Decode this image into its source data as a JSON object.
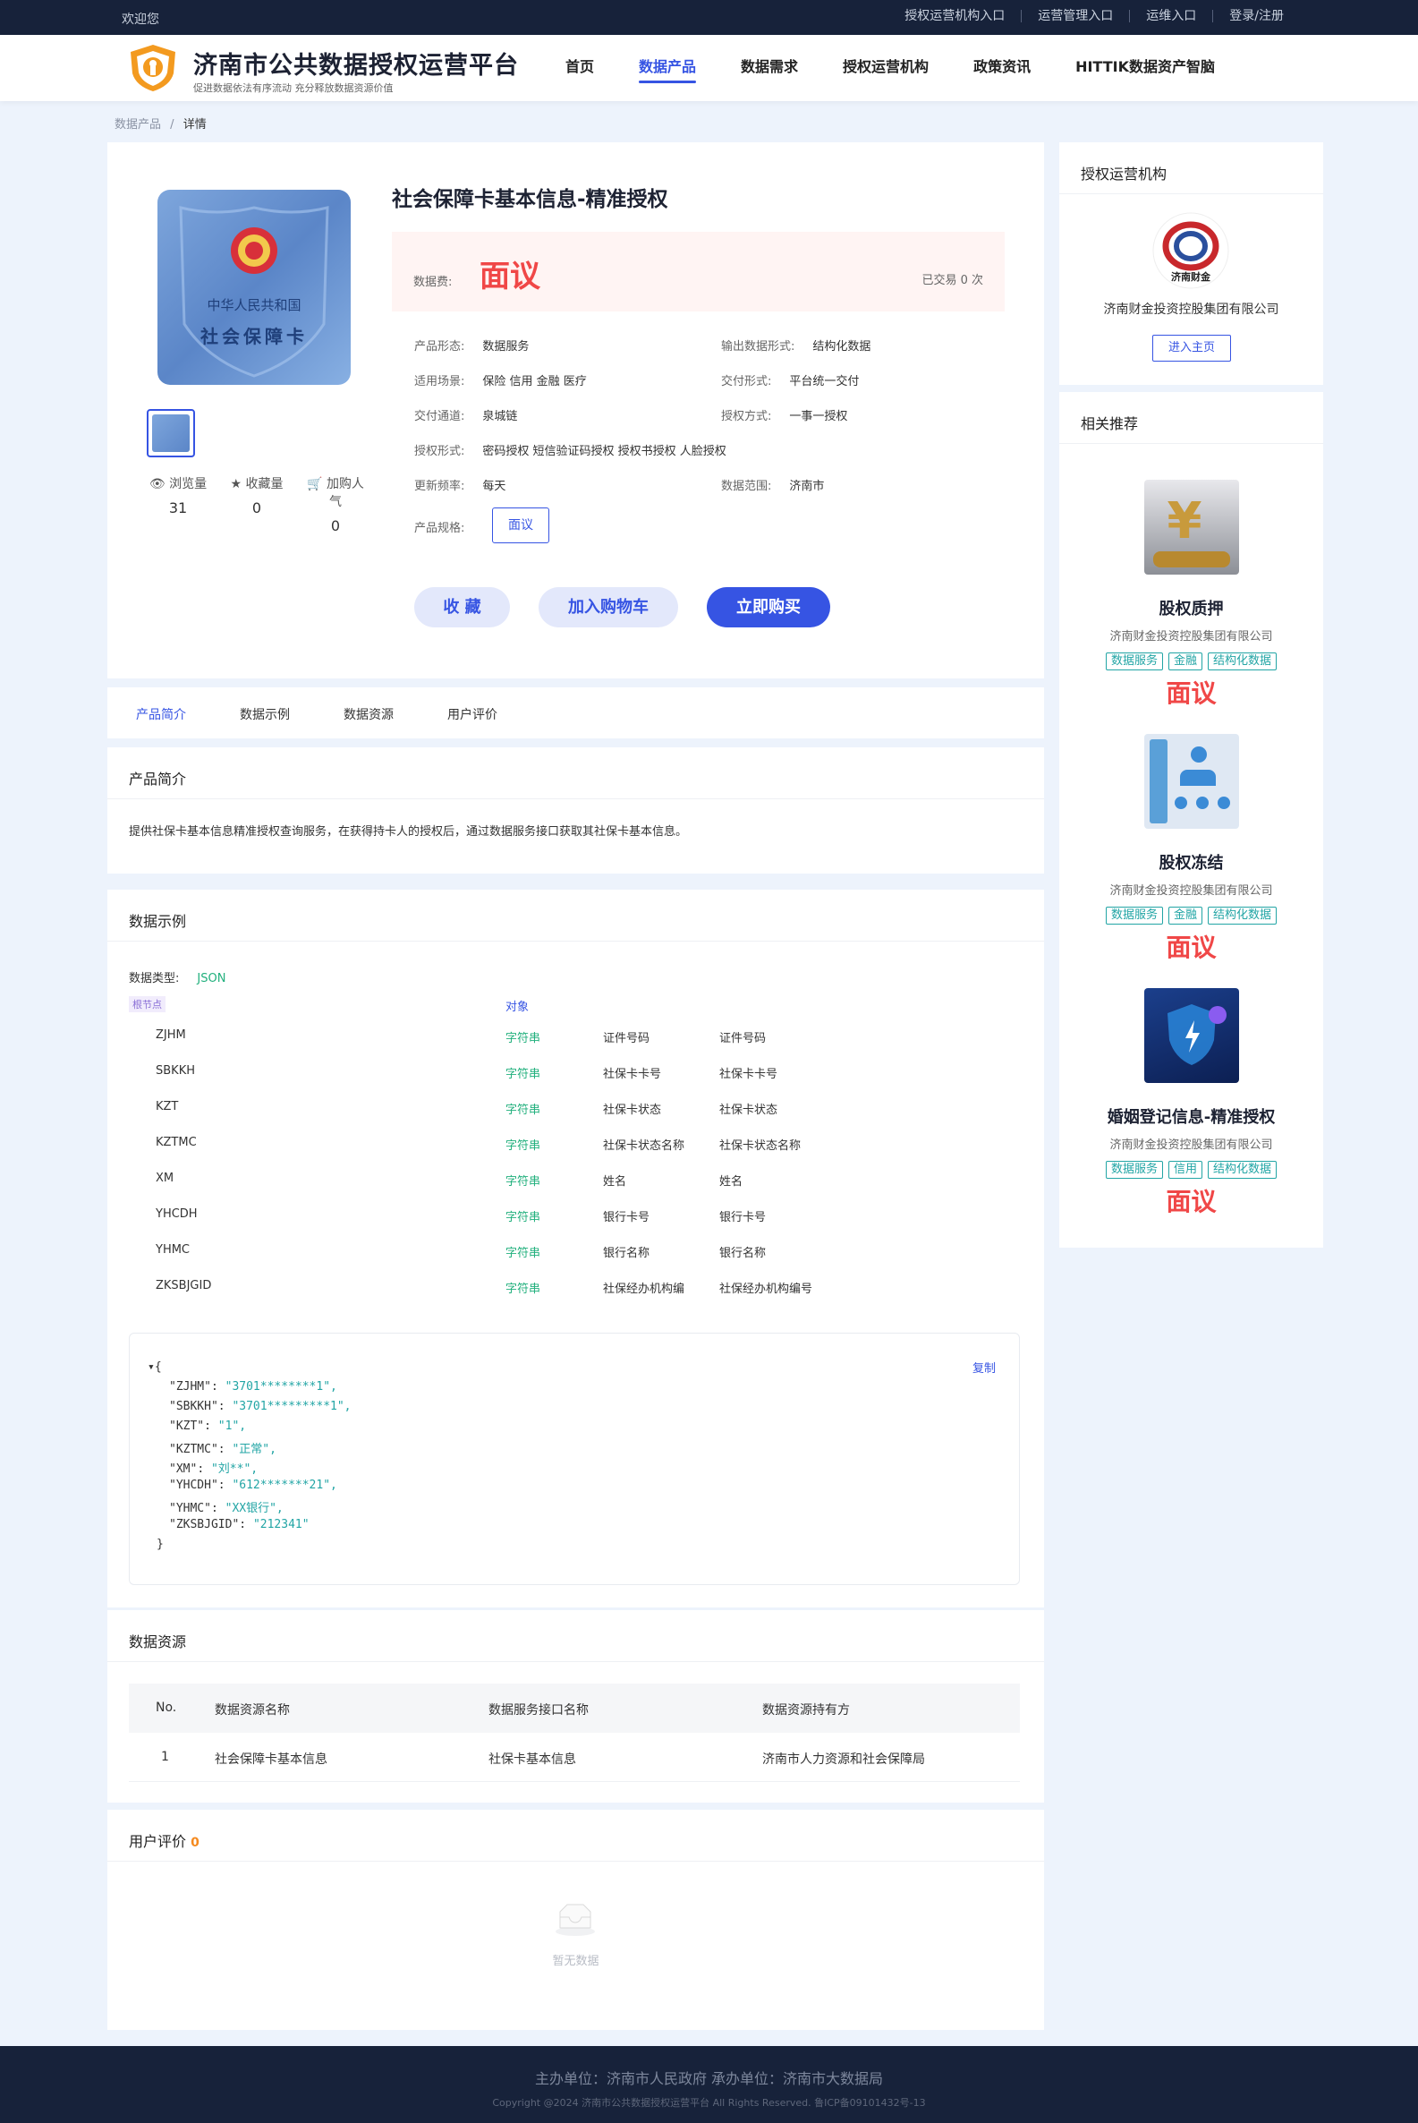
{
  "topbar": {
    "welcome": "欢迎您",
    "links": [
      "授权运营机构入口",
      "运营管理入口",
      "运维入口",
      "登录/注册"
    ]
  },
  "header": {
    "brand": "济南市公共数据授权运营平台",
    "sub": "促进数据依法有序流动 充分释放数据资源价值",
    "nav": [
      "首页",
      "数据产品",
      "数据需求",
      "授权运营机构",
      "政策资讯",
      "HITTIK数据资产智脑"
    ]
  },
  "breadcrumb": {
    "parent": "数据产品",
    "sep": "/",
    "current": "详情"
  },
  "product": {
    "card_text1": "中华人民共和国",
    "card_text2": "社会保障卡",
    "title": "社会保障卡基本信息-精准授权",
    "price_label": "数据费:",
    "price": "面议",
    "deals": "已交易 0 次",
    "stats": [
      {
        "icon": "eye-icon",
        "label": "浏览量",
        "value": "31"
      },
      {
        "icon": "star-icon",
        "label": "收藏量",
        "value": "0"
      },
      {
        "icon": "cart-icon",
        "label": "加购人气",
        "value": "0"
      }
    ],
    "attrs": [
      {
        "k": "产品形态:",
        "v": "数据服务"
      },
      {
        "k": "输出数据形式:",
        "v": "结构化数据"
      },
      {
        "k": "适用场景:",
        "v": "保险  信用  金融  医疗"
      },
      {
        "k": "交付形式:",
        "v": "平台统一交付"
      },
      {
        "k": "交付通道:",
        "v": "泉城链"
      },
      {
        "k": "授权方式:",
        "v": "一事一授权"
      },
      {
        "k": "授权形式:",
        "v": "密码授权  短信验证码授权  授权书授权  人脸授权"
      },
      {
        "k": "更新频率:",
        "v": "每天"
      },
      {
        "k": "数据范围:",
        "v": "济南市"
      }
    ],
    "spec_label": "产品规格:",
    "spec": "面议",
    "buttons": {
      "fav": "收 藏",
      "cart": "加入购物车",
      "buy": "立即购买"
    }
  },
  "tabs": [
    "产品简介",
    "数据示例",
    "数据资源",
    "用户评价"
  ],
  "intro": {
    "title": "产品简介",
    "text": "提供社保卡基本信息精准授权查询服务，在获得持卡人的授权后，通过数据服务接口获取其社保卡基本信息。"
  },
  "sample": {
    "title": "数据示例",
    "type_label": "数据类型:",
    "type": "JSON",
    "root": "根节点",
    "root_type": "对象",
    "fields": [
      {
        "k": "ZJHM",
        "t": "字符串",
        "a": "证件号码",
        "b": "证件号码"
      },
      {
        "k": "SBKKH",
        "t": "字符串",
        "a": "社保卡卡号",
        "b": "社保卡卡号"
      },
      {
        "k": "KZT",
        "t": "字符串",
        "a": "社保卡状态",
        "b": "社保卡状态"
      },
      {
        "k": "KZTMC",
        "t": "字符串",
        "a": "社保卡状态名称",
        "b": "社保卡状态名称"
      },
      {
        "k": "XM",
        "t": "字符串",
        "a": "姓名",
        "b": "姓名"
      },
      {
        "k": "YHCDH",
        "t": "字符串",
        "a": "银行卡号",
        "b": "银行卡号"
      },
      {
        "k": "YHMC",
        "t": "字符串",
        "a": "银行名称",
        "b": "银行名称"
      },
      {
        "k": "ZKSBJGID",
        "t": "字符串",
        "a": "社保经办机构编",
        "b": "社保经办机构编号"
      }
    ],
    "copy": "复制",
    "json_open": "{",
    "json_close": "}",
    "json": [
      {
        "k": "\"ZJHM\"",
        "v": "\"3701********1\","
      },
      {
        "k": "\"SBKKH\"",
        "v": "\"3701*********1\","
      },
      {
        "k": "\"KZT\"",
        "v": "\"1\","
      },
      {
        "k": "\"KZTMC\"",
        "v": "\"正常\","
      },
      {
        "k": "\"XM\"",
        "v": "\"刘**\","
      },
      {
        "k": "\"YHCDH\"",
        "v": "\"612*******21\","
      },
      {
        "k": "\"YHMC\"",
        "v": "\"XX银行\","
      },
      {
        "k": "\"ZKSBJGID\"",
        "v": "\"212341\""
      }
    ]
  },
  "resources": {
    "title": "数据资源",
    "headers": [
      "No.",
      "数据资源名称",
      "数据服务接口名称",
      "数据资源持有方"
    ],
    "rows": [
      [
        "1",
        "社会保障卡基本信息",
        "社保卡基本信息",
        "济南市人力资源和社会保障局"
      ]
    ]
  },
  "reviews": {
    "title": "用户评价",
    "count": "0",
    "empty": "暂无数据"
  },
  "sidebar": {
    "org_title": "授权运营机构",
    "org_logo_text": "济南财金",
    "org_name": "济南财金投资控股集团有限公司",
    "org_btn": "进入主页",
    "rec_title": "相关推荐",
    "recs": [
      {
        "name": "股权质押",
        "company": "济南财金投资控股集团有限公司",
        "tags": [
          "数据服务",
          "金融",
          "结构化数据"
        ],
        "price": "面议"
      },
      {
        "name": "股权冻结",
        "company": "济南财金投资控股集团有限公司",
        "tags": [
          "数据服务",
          "金融",
          "结构化数据"
        ],
        "price": "面议"
      },
      {
        "name": "婚姻登记信息-精准授权",
        "company": "济南财金投资控股集团有限公司",
        "tags": [
          "数据服务",
          "信用",
          "结构化数据"
        ],
        "price": "面议"
      }
    ]
  },
  "footer": {
    "line1": "主办单位：济南市人民政府    承办单位：济南市大数据局",
    "line2": "Copyright @2024 济南市公共数据授权运营平台 All Rights Reserved. 鲁ICP备09101432号-13"
  }
}
